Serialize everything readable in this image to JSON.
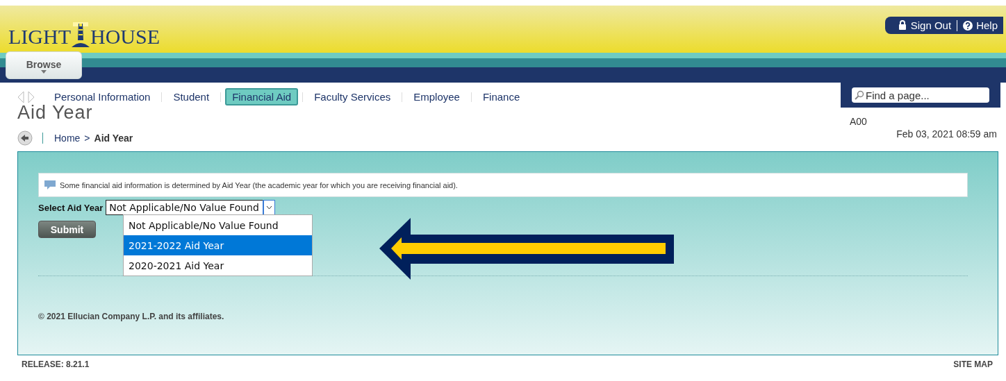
{
  "logo": {
    "left": "LIGHT",
    "right": "HOUSE"
  },
  "top_links": [
    {
      "kind": "lock",
      "label": "Sign Out"
    },
    {
      "kind": "help",
      "label": "Help"
    }
  ],
  "browse_tab": {
    "label": "Browse"
  },
  "nav": [
    {
      "label": "Personal Information",
      "selected": false
    },
    {
      "label": "Student",
      "selected": false
    },
    {
      "label": "Financial Aid",
      "selected": true
    },
    {
      "label": "Faculty Services",
      "selected": false
    },
    {
      "label": "Employee",
      "selected": false
    },
    {
      "label": "Finance",
      "selected": false
    }
  ],
  "search": {
    "placeholder": "Find a page..."
  },
  "page_title": "Aid Year",
  "breadcrumb": {
    "home": "Home",
    "separator": ">",
    "current": "Aid Year"
  },
  "user_id": "A00",
  "timestamp": "Feb 03, 2021 08:59 am",
  "info_message": "Some financial aid information is determined by Aid Year (the academic year for which you are receiving financial aid).",
  "select": {
    "label": "Select Aid Year",
    "value": "Not Applicable/No Value Found",
    "expanded": true,
    "options": [
      {
        "label": "Not Applicable/No Value Found",
        "highlighted": false
      },
      {
        "label": "2021-2022 Aid Year",
        "highlighted": true
      },
      {
        "label": "2020-2021 Aid Year",
        "highlighted": false
      }
    ]
  },
  "submit_button": "Submit",
  "copyright": "© 2021 Ellucian Company L.P. and its affiliates.",
  "release": "RELEASE: 8.21.1",
  "site_map": "SITE MAP"
}
